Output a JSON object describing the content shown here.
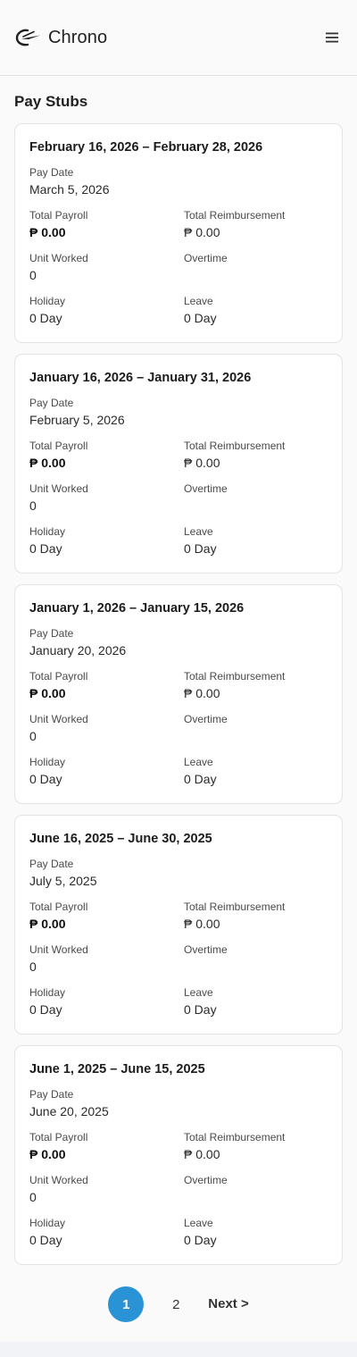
{
  "app": {
    "name": "Chrono"
  },
  "icons": {
    "logo": "chrono-logo-icon",
    "menu": "hamburger-menu-icon"
  },
  "colors": {
    "accent": "#2a93d5"
  },
  "page_title": "Pay Stubs",
  "labels": {
    "pay_date": "Pay Date",
    "total_payroll": "Total Payroll",
    "total_reimbursement": "Total Reimbursement",
    "unit_worked": "Unit Worked",
    "overtime": "Overtime",
    "holiday": "Holiday",
    "leave": "Leave"
  },
  "stubs": [
    {
      "period": "February 16, 2026 – February 28, 2026",
      "pay_date": "March 5, 2026",
      "total_payroll": "₱ 0.00",
      "total_reimbursement": "₱ 0.00",
      "unit_worked": "0",
      "overtime": "",
      "holiday": "0 Day",
      "leave": "0 Day"
    },
    {
      "period": "January 16, 2026 – January 31, 2026",
      "pay_date": "February 5, 2026",
      "total_payroll": "₱ 0.00",
      "total_reimbursement": "₱ 0.00",
      "unit_worked": "0",
      "overtime": "",
      "holiday": "0 Day",
      "leave": "0 Day"
    },
    {
      "period": "January 1, 2026 – January 15, 2026",
      "pay_date": "January 20, 2026",
      "total_payroll": "₱ 0.00",
      "total_reimbursement": "₱ 0.00",
      "unit_worked": "0",
      "overtime": "",
      "holiday": "0 Day",
      "leave": "0 Day"
    },
    {
      "period": "June 16, 2025 – June 30, 2025",
      "pay_date": "July 5, 2025",
      "total_payroll": "₱ 0.00",
      "total_reimbursement": "₱ 0.00",
      "unit_worked": "0",
      "overtime": "",
      "holiday": "0 Day",
      "leave": "0 Day"
    },
    {
      "period": "June 1, 2025 – June 15, 2025",
      "pay_date": "June 20, 2025",
      "total_payroll": "₱ 0.00",
      "total_reimbursement": "₱ 0.00",
      "unit_worked": "0",
      "overtime": "",
      "holiday": "0 Day",
      "leave": "0 Day"
    }
  ],
  "pagination": {
    "pages": [
      "1",
      "2"
    ],
    "current": "1",
    "next_label": "Next >"
  }
}
